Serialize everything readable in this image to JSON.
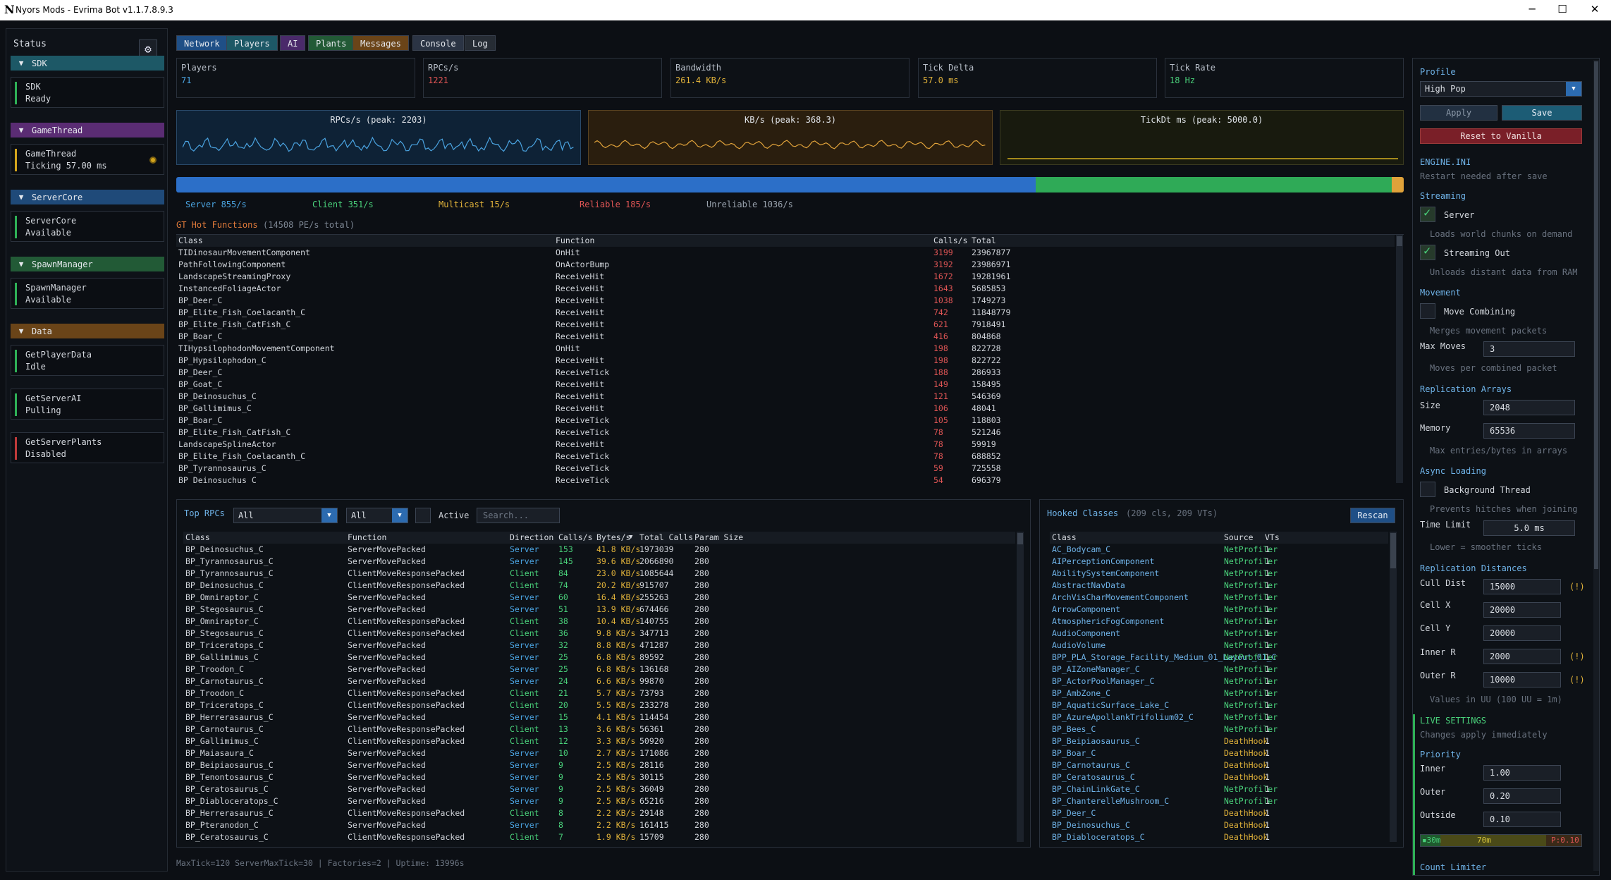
{
  "window": {
    "logo": "N",
    "title": "Nyors Mods - Evrima Bot v1.1.7.8.9.3",
    "min": "─",
    "max": "☐",
    "close": "✕"
  },
  "sidebar": {
    "status": "Status",
    "gear": "⚙",
    "sections": [
      {
        "name": "SDK",
        "color": "#1d5866",
        "cards": [
          {
            "title": "SDK",
            "state": "Ready",
            "bar": "#2fb157"
          }
        ]
      },
      {
        "name": "GameThread",
        "color": "#5a2c73",
        "cards": [
          {
            "title": "GameThread",
            "state": "Ticking 57.00 ms",
            "bar": "#d4a51c",
            "dot": true
          }
        ]
      },
      {
        "name": "ServerCore",
        "color": "#1f4a79",
        "cards": [
          {
            "title": "ServerCore",
            "state": "Available",
            "bar": "#2fb157"
          }
        ]
      },
      {
        "name": "SpawnManager",
        "color": "#225a36",
        "cards": [
          {
            "title": "SpawnManager",
            "state": "Available",
            "bar": "#2fb157"
          }
        ]
      },
      {
        "name": "Data",
        "color": "#6a4418",
        "cards": [
          {
            "title": "GetPlayerData",
            "state": "Idle",
            "bar": "#2fb157"
          },
          {
            "title": "GetServerAI",
            "state": "Pulling",
            "bar": "#2fb157"
          },
          {
            "title": "GetServerPlants",
            "state": "Disabled",
            "bar": "#c03a3a"
          }
        ]
      }
    ]
  },
  "tabs": [
    {
      "label": "Network",
      "bg": "#1f4f86"
    },
    {
      "label": "Players",
      "bg": "#1d5866"
    },
    {
      "label": "AI",
      "bg": "#4a2a6a"
    },
    {
      "label": "Plants",
      "bg": "#225a36"
    },
    {
      "label": "Messages",
      "bg": "#6a4418"
    },
    {
      "label": "Console",
      "bg": "#2b3444"
    },
    {
      "label": "Log",
      "bg": "#262c34"
    }
  ],
  "stats": [
    {
      "label": "Players",
      "value": "71",
      "color": "#4aa3e0"
    },
    {
      "label": "RPCs/s",
      "value": "1221",
      "color": "#e05555"
    },
    {
      "label": "Bandwidth",
      "value": "261.4 KB/s",
      "color": "#e0b23a"
    },
    {
      "label": "Tick Delta",
      "value": "57.0 ms",
      "color": "#e0b23a"
    },
    {
      "label": "Tick Rate",
      "value": "18 Hz",
      "color": "#49d07a"
    }
  ],
  "graphs": [
    {
      "title": "RPCs/s (peak: 2203)"
    },
    {
      "title": "KB/s (peak: 368.3)"
    },
    {
      "title": "TickDt ms (peak: 5000.0)"
    }
  ],
  "traffic": {
    "server": "Server 855/s",
    "client": "Client 351/s",
    "multicast": "Multicast 15/s",
    "reliable": "Reliable 185/s",
    "unreliable": "Unreliable 1036/s",
    "server_frac": 0.7,
    "client_frac": 0.29
  },
  "gt": {
    "title": "GT Hot Functions",
    "subtitle": "(14508 PE/s total)",
    "headers": [
      "Class",
      "Function",
      "Calls/s",
      "Total"
    ],
    "rows": [
      [
        "TIDinosaurMovementComponent",
        "OnHit",
        "3199",
        "23967877"
      ],
      [
        "PathFollowingComponent",
        "OnActorBump",
        "3192",
        "23986971"
      ],
      [
        "LandscapeStreamingProxy",
        "ReceiveHit",
        "1672",
        "19281961"
      ],
      [
        "InstancedFoliageActor",
        "ReceiveHit",
        "1643",
        "5685853"
      ],
      [
        "BP_Deer_C",
        "ReceiveHit",
        "1038",
        "1749273"
      ],
      [
        "BP_Elite_Fish_Coelacanth_C",
        "ReceiveHit",
        "742",
        "11848779"
      ],
      [
        "BP_Elite_Fish_CatFish_C",
        "ReceiveHit",
        "621",
        "7918491"
      ],
      [
        "BP_Boar_C",
        "ReceiveHit",
        "416",
        "804868"
      ],
      [
        "TIHypsilophodonMovementComponent",
        "OnHit",
        "198",
        "822728"
      ],
      [
        "BP_Hypsilophodon_C",
        "ReceiveHit",
        "198",
        "822722"
      ],
      [
        "BP_Deer_C",
        "ReceiveTick",
        "188",
        "286933"
      ],
      [
        "BP_Goat_C",
        "ReceiveHit",
        "149",
        "158495"
      ],
      [
        "BP_Deinosuchus_C",
        "ReceiveHit",
        "121",
        "546369"
      ],
      [
        "BP_Gallimimus_C",
        "ReceiveHit",
        "106",
        "48041"
      ],
      [
        "BP_Boar_C",
        "ReceiveTick",
        "105",
        "118803"
      ],
      [
        "BP_Elite_Fish_CatFish_C",
        "ReceiveTick",
        "78",
        "521246"
      ],
      [
        "LandscapeSplineActor",
        "ReceiveHit",
        "78",
        "59919"
      ],
      [
        "BP_Elite_Fish_Coelacanth_C",
        "ReceiveTick",
        "78",
        "688852"
      ],
      [
        "BP_Tyrannosaurus_C",
        "ReceiveTick",
        "59",
        "725558"
      ],
      [
        "BP_Deinosuchus_C",
        "ReceiveTick",
        "54",
        "696379"
      ]
    ]
  },
  "rpcs": {
    "title": "Top RPCs",
    "filter1": "All",
    "filter2": "All",
    "active": "Active",
    "search_placeholder": "Search...",
    "sort_arrow": "▼",
    "headers": [
      "Class",
      "Function",
      "Direction",
      "Calls/s",
      "Bytes/s",
      "Total Calls",
      "Param Size"
    ],
    "rows": [
      [
        "BP_Deinosuchus_C",
        "ServerMovePacked",
        "Server",
        "153",
        "41.8 KB/s",
        "1973039",
        "280"
      ],
      [
        "BP_Tyrannosaurus_C",
        "ServerMovePacked",
        "Server",
        "145",
        "39.6 KB/s",
        "2066890",
        "280"
      ],
      [
        "BP_Tyrannosaurus_C",
        "ClientMoveResponsePacked",
        "Client",
        "84",
        "23.0 KB/s",
        "1085644",
        "280"
      ],
      [
        "BP_Deinosuchus_C",
        "ClientMoveResponsePacked",
        "Client",
        "74",
        "20.2 KB/s",
        "915707",
        "280"
      ],
      [
        "BP_Omniraptor_C",
        "ServerMovePacked",
        "Server",
        "60",
        "16.4 KB/s",
        "255263",
        "280"
      ],
      [
        "BP_Stegosaurus_C",
        "ServerMovePacked",
        "Server",
        "51",
        "13.9 KB/s",
        "674466",
        "280"
      ],
      [
        "BP_Omniraptor_C",
        "ClientMoveResponsePacked",
        "Client",
        "38",
        "10.4 KB/s",
        "140755",
        "280"
      ],
      [
        "BP_Stegosaurus_C",
        "ClientMoveResponsePacked",
        "Client",
        "36",
        "9.8 KB/s",
        "347713",
        "280"
      ],
      [
        "BP_Triceratops_C",
        "ServerMovePacked",
        "Server",
        "32",
        "8.8 KB/s",
        "471287",
        "280"
      ],
      [
        "BP_Gallimimus_C",
        "ServerMovePacked",
        "Server",
        "25",
        "6.8 KB/s",
        "89592",
        "280"
      ],
      [
        "BP_Troodon_C",
        "ServerMovePacked",
        "Server",
        "25",
        "6.8 KB/s",
        "136168",
        "280"
      ],
      [
        "BP_Carnotaurus_C",
        "ServerMovePacked",
        "Server",
        "24",
        "6.6 KB/s",
        "99870",
        "280"
      ],
      [
        "BP_Troodon_C",
        "ClientMoveResponsePacked",
        "Client",
        "21",
        "5.7 KB/s",
        "73793",
        "280"
      ],
      [
        "BP_Triceratops_C",
        "ClientMoveResponsePacked",
        "Client",
        "20",
        "5.5 KB/s",
        "233278",
        "280"
      ],
      [
        "BP_Herrerasaurus_C",
        "ServerMovePacked",
        "Server",
        "15",
        "4.1 KB/s",
        "114454",
        "280"
      ],
      [
        "BP_Carnotaurus_C",
        "ClientMoveResponsePacked",
        "Client",
        "13",
        "3.6 KB/s",
        "56361",
        "280"
      ],
      [
        "BP_Gallimimus_C",
        "ClientMoveResponsePacked",
        "Client",
        "12",
        "3.3 KB/s",
        "50920",
        "280"
      ],
      [
        "BP_Maiasaura_C",
        "ServerMovePacked",
        "Server",
        "10",
        "2.7 KB/s",
        "171086",
        "280"
      ],
      [
        "BP_Beipiaosaurus_C",
        "ServerMovePacked",
        "Server",
        "9",
        "2.5 KB/s",
        "28116",
        "280"
      ],
      [
        "BP_Tenontosaurus_C",
        "ServerMovePacked",
        "Server",
        "9",
        "2.5 KB/s",
        "30115",
        "280"
      ],
      [
        "BP_Ceratosaurus_C",
        "ServerMovePacked",
        "Server",
        "9",
        "2.5 KB/s",
        "36049",
        "280"
      ],
      [
        "BP_Diabloceratops_C",
        "ServerMovePacked",
        "Server",
        "9",
        "2.5 KB/s",
        "65216",
        "280"
      ],
      [
        "BP_Herrerasaurus_C",
        "ClientMoveResponsePacked",
        "Client",
        "8",
        "2.2 KB/s",
        "29148",
        "280"
      ],
      [
        "BP_Pteranodon_C",
        "ServerMovePacked",
        "Server",
        "8",
        "2.2 KB/s",
        "161415",
        "280"
      ],
      [
        "BP_Ceratosaurus_C",
        "ClientMoveResponsePacked",
        "Client",
        "7",
        "1.9 KB/s",
        "15709",
        "280"
      ]
    ]
  },
  "hooked": {
    "title": "Hooked Classes",
    "subtitle": "(209 cls, 209 VTs)",
    "rescan": "Rescan",
    "headers": [
      "Class",
      "Source",
      "VTs"
    ],
    "rows": [
      [
        "AC_Bodycam_C",
        "NetProfiler",
        "1"
      ],
      [
        "AIPerceptionComponent",
        "NetProfiler",
        "1"
      ],
      [
        "AbilitySystemComponent",
        "NetProfiler",
        "1"
      ],
      [
        "AbstractNavData",
        "NetProfiler",
        "1"
      ],
      [
        "ArchVisCharMovementComponent",
        "NetProfiler",
        "1"
      ],
      [
        "ArrowComponent",
        "NetProfiler",
        "1"
      ],
      [
        "AtmosphericFogComponent",
        "NetProfiler",
        "1"
      ],
      [
        "AudioComponent",
        "NetProfiler",
        "1"
      ],
      [
        "AudioVolume",
        "NetProfiler",
        "1"
      ],
      [
        "BPP_PLA_Storage_Facility_Medium_01_Layout_01_C",
        "NetProfiler",
        "1"
      ],
      [
        "BP_AIZoneManager_C",
        "NetProfiler",
        "1"
      ],
      [
        "BP_ActorPoolManager_C",
        "NetProfiler",
        "1"
      ],
      [
        "BP_AmbZone_C",
        "NetProfiler",
        "1"
      ],
      [
        "BP_AquaticSurface_Lake_C",
        "NetProfiler",
        "1"
      ],
      [
        "BP_AzureApollankTrifolium02_C",
        "NetProfiler",
        "1"
      ],
      [
        "BP_Bees_C",
        "NetProfiler",
        "1"
      ],
      [
        "BP_Beipiaosaurus_C",
        "DeathHook",
        "1"
      ],
      [
        "BP_Boar_C",
        "DeathHook",
        "1"
      ],
      [
        "BP_Carnotaurus_C",
        "DeathHook",
        "1"
      ],
      [
        "BP_Ceratosaurus_C",
        "DeathHook",
        "1"
      ],
      [
        "BP_ChainLinkGate_C",
        "NetProfiler",
        "1"
      ],
      [
        "BP_ChanterelleMushroom_C",
        "NetProfiler",
        "1"
      ],
      [
        "BP_Deer_C",
        "DeathHook",
        "1"
      ],
      [
        "BP_Deinosuchus_C",
        "DeathHook",
        "1"
      ],
      [
        "BP_Diabloceratops_C",
        "DeathHook",
        "1"
      ]
    ]
  },
  "footer": "MaxTick=120 ServerMaxTick=30 | Factories=2 | Uptime: 13996s",
  "right": {
    "profile_label": "Profile",
    "profile_value": "High Pop",
    "apply": "Apply",
    "save": "Save",
    "reset": "Reset to Vanilla",
    "engine_ini": "ENGINE.INI",
    "restart_note": "Restart needed after save",
    "streaming": "Streaming",
    "server": "Server",
    "server_desc": "Loads world chunks on demand",
    "streaming_out": "Streaming Out",
    "streaming_out_desc": "Unloads distant data from RAM",
    "movement": "Movement",
    "move_combining": "Move Combining",
    "move_combining_desc": "Merges movement packets",
    "max_moves_label": "Max Moves",
    "max_moves": "3",
    "max_moves_desc": "Moves per combined packet",
    "rep_arrays": "Replication Arrays",
    "size_label": "Size",
    "size": "2048",
    "memory_label": "Memory",
    "memory": "65536",
    "rep_desc": "Max entries/bytes in arrays",
    "async": "Async Loading",
    "bg_thread": "Background Thread",
    "bg_thread_desc": "Prevents hitches when joining",
    "time_limit_label": "Time Limit",
    "time_limit": "5.0",
    "time_limit_unit": "ms",
    "time_limit_desc": "Lower = smoother ticks",
    "rep_dist": "Replication Distances",
    "cull_label": "Cull Dist",
    "cull": "15000",
    "cellx_label": "Cell X",
    "cellx": "20000",
    "celly_label": "Cell Y",
    "celly": "20000",
    "inner_label": "Inner R",
    "inner": "2000",
    "outer_label": "Outer R",
    "outer": "10000",
    "warn": "(!)",
    "dist_desc": "Values in UU (100 UU = 1m)",
    "live": "LIVE SETTINGS",
    "live_desc": "Changes apply immediately",
    "priority": "Priority",
    "p_inner_label": "Inner",
    "p_inner": "1.00",
    "p_outer_label": "Outer",
    "p_outer": "0.20",
    "p_outside_label": "Outside",
    "p_outside": "0.10",
    "bar_30": "30m",
    "bar_70": "70m",
    "bar_p": "P:0.10",
    "count_limiter": "Count Limiter"
  }
}
